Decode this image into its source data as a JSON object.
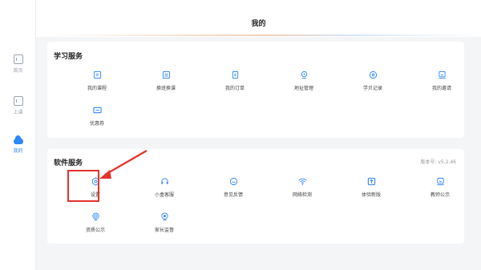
{
  "sidebar": {
    "items": [
      {
        "label": "首页",
        "icon": "home-icon"
      },
      {
        "label": "上课",
        "icon": "class-icon"
      },
      {
        "label": "我的",
        "icon": "cloud-icon"
      }
    ]
  },
  "header": {
    "title": "我的"
  },
  "study": {
    "title": "学习服务",
    "items": [
      {
        "label": "我的课程",
        "icon": "course-icon"
      },
      {
        "label": "换班换课",
        "icon": "swap-class-icon"
      },
      {
        "label": "我的订单",
        "icon": "order-icon"
      },
      {
        "label": "地址管理",
        "icon": "location-icon"
      },
      {
        "label": "学贝记录",
        "icon": "coin-icon"
      },
      {
        "label": "我的邀请",
        "icon": "invite-icon"
      },
      {
        "label": "优惠券",
        "icon": "coupon-icon"
      }
    ]
  },
  "software": {
    "title": "软件服务",
    "version": "版本号: v5.2.46",
    "items": [
      {
        "label": "设置",
        "icon": "settings-icon"
      },
      {
        "label": "小盒客服",
        "icon": "headset-icon"
      },
      {
        "label": "意见反馈",
        "icon": "feedback-icon"
      },
      {
        "label": "网络检测",
        "icon": "wifi-icon"
      },
      {
        "label": "体验新版",
        "icon": "new-version-icon"
      },
      {
        "label": "教师公示",
        "icon": "teacher-icon"
      },
      {
        "label": "资质公示",
        "icon": "certificate-icon"
      },
      {
        "label": "家长监督",
        "icon": "camera-icon"
      }
    ]
  },
  "colors": {
    "accent": "#2f86f6",
    "highlight": "#e5322d",
    "background": "#f4f5f7"
  }
}
